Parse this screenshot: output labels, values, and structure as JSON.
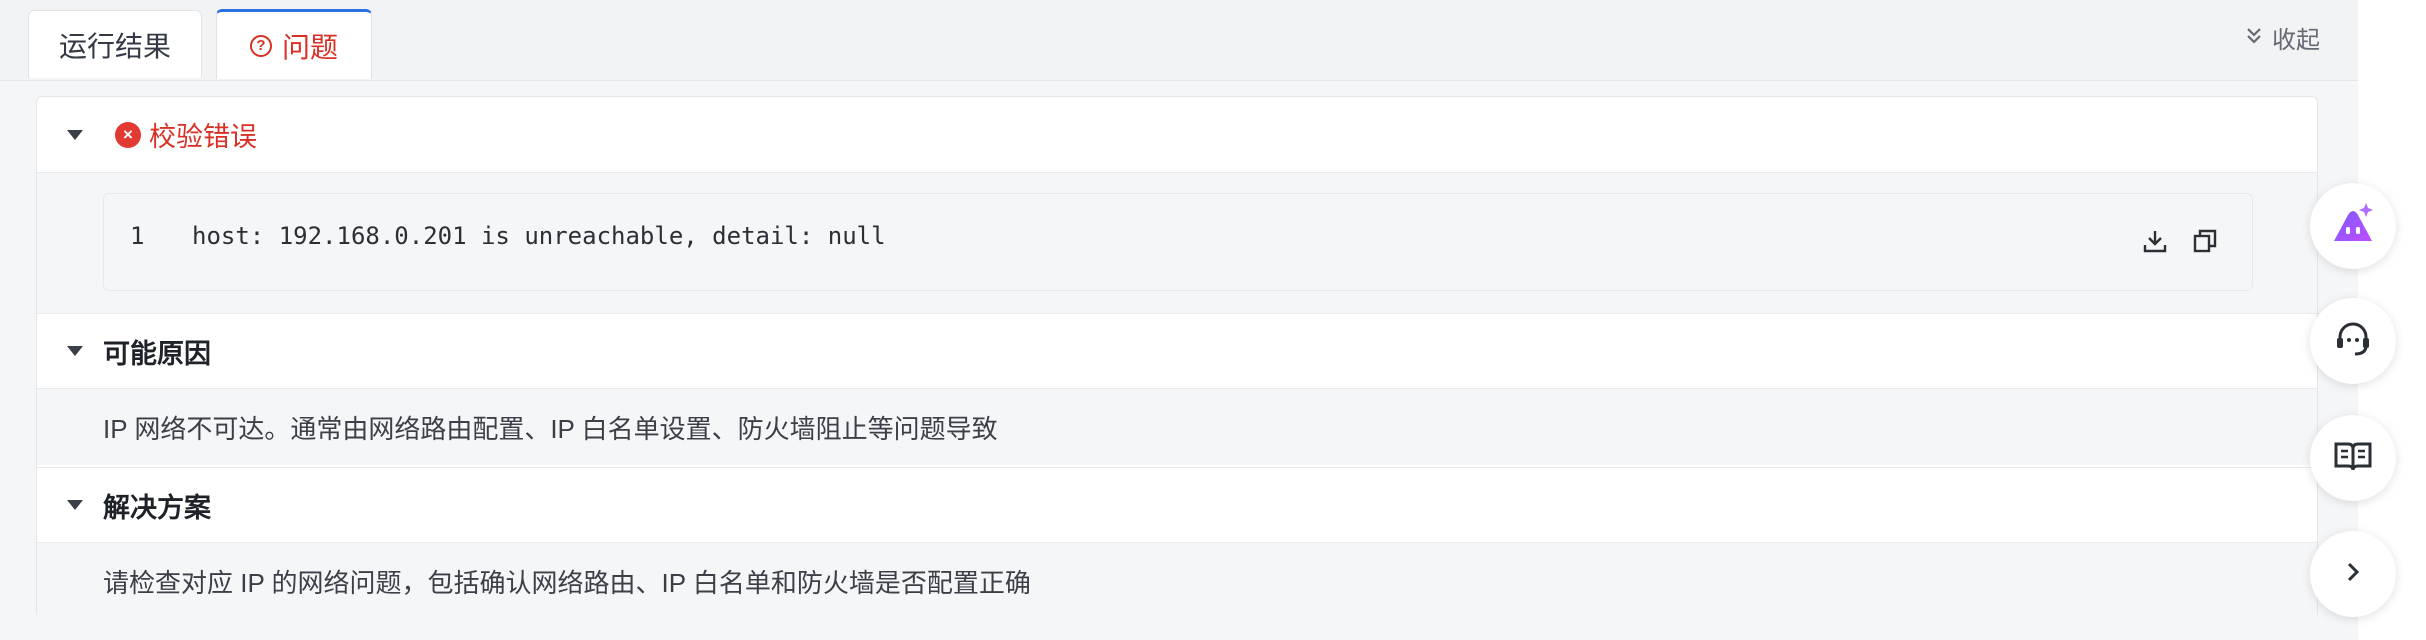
{
  "tabs": {
    "result_label": "运行结果",
    "problem_label": "问题",
    "collapse_label": "收起"
  },
  "error_section": {
    "title": "校验错误",
    "code": {
      "line_number": "1",
      "text": "host: 192.168.0.201 is unreachable, detail: null"
    }
  },
  "cause_section": {
    "title": "可能原因",
    "text": "IP 网络不可达。通常由网络路由配置、IP 白名单设置、防火墙阻止等问题导致"
  },
  "solution_section": {
    "title": "解决方案",
    "text": "请检查对应 IP 的网络问题，包括确认网络路由、IP 白名单和防火墙是否配置正确"
  },
  "icons": [
    "question-circle-icon",
    "chevron-double-down-icon",
    "error-circle-icon",
    "download-icon",
    "copy-icon",
    "ai-assistant-icon",
    "headset-icon",
    "book-icon",
    "chevron-right-icon"
  ],
  "colors": {
    "error": "#d93026",
    "accent": "#2f6fe4",
    "ai_gradient_start": "#7b5cff",
    "ai_gradient_end": "#c04dff"
  }
}
